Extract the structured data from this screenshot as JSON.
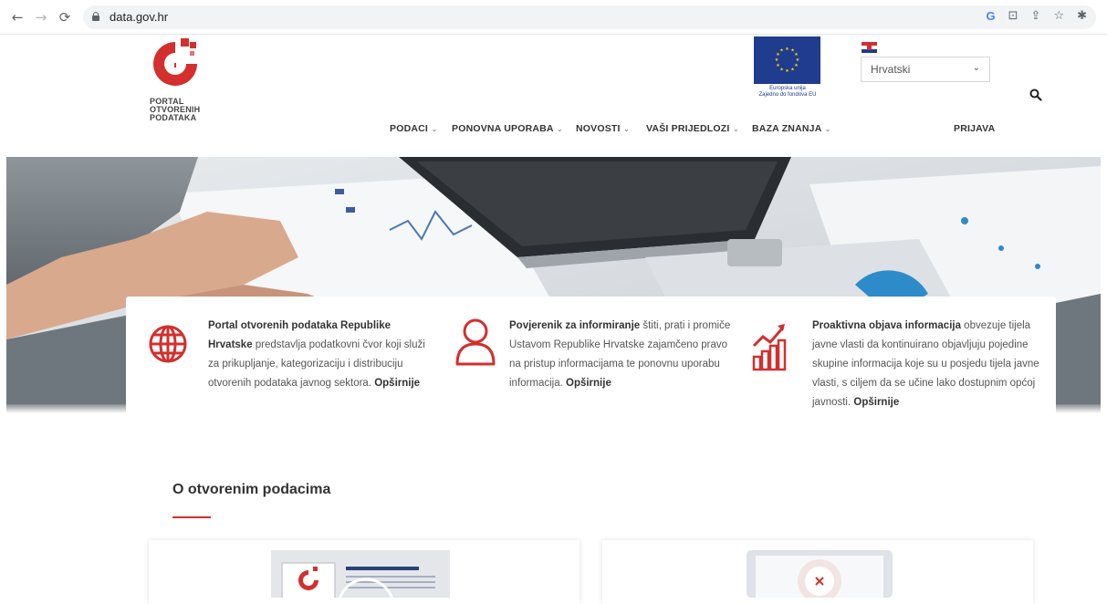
{
  "browser": {
    "url": "data.gov.hr",
    "back_icon": "arrow-left-icon",
    "forward_icon": "arrow-right-icon",
    "reload_icon": "reload-icon"
  },
  "header": {
    "logo_text": [
      "PORTAL",
      "OTVORENIH",
      "PODATAKA"
    ],
    "eu_caption": [
      "Europska unija",
      "Zajedno do fondova EU"
    ],
    "language": "Hrvatski",
    "login": "PRIJAVA"
  },
  "nav": {
    "items": [
      {
        "label": "PODACI"
      },
      {
        "label": "PONOVNA UPORABA"
      },
      {
        "label": "NOVOSTI"
      },
      {
        "label": "VAŠI PRIJEDLOZI"
      },
      {
        "label": "BAZA ZNANJA"
      }
    ]
  },
  "info": {
    "portal": {
      "bold": "Portal otvorenih podataka Republike Hrvatske",
      "text": " predstavlja podatkovni čvor koji služi za prikupljanje, kategorizaciju i distribuciju otvorenih podataka javnog sektora. ",
      "more": "Opširnije"
    },
    "commissioner": {
      "bold": "Povjerenik za informiranje",
      "text": " štiti, prati i promiče Ustavom Republike Hrvatske zajamčeno pravo na pristup informacijama te ponovnu uporabu informacija. ",
      "more": "Opširnije"
    },
    "proactive": {
      "bold": "Proaktivna objava informacija",
      "text": " obvezuje tijela javne vlasti da kontinuirano objavljuju pojedine skupine informacija koje su u posjedu tijela javne vlasti, s ciljem da se učine lako dostupnim općoj javnosti. ",
      "more": "Opširnije"
    }
  },
  "about": {
    "title": "O otvorenim podacima"
  },
  "colors": {
    "brand_red": "#d32f2f",
    "eu_blue": "#1f3c8f"
  }
}
